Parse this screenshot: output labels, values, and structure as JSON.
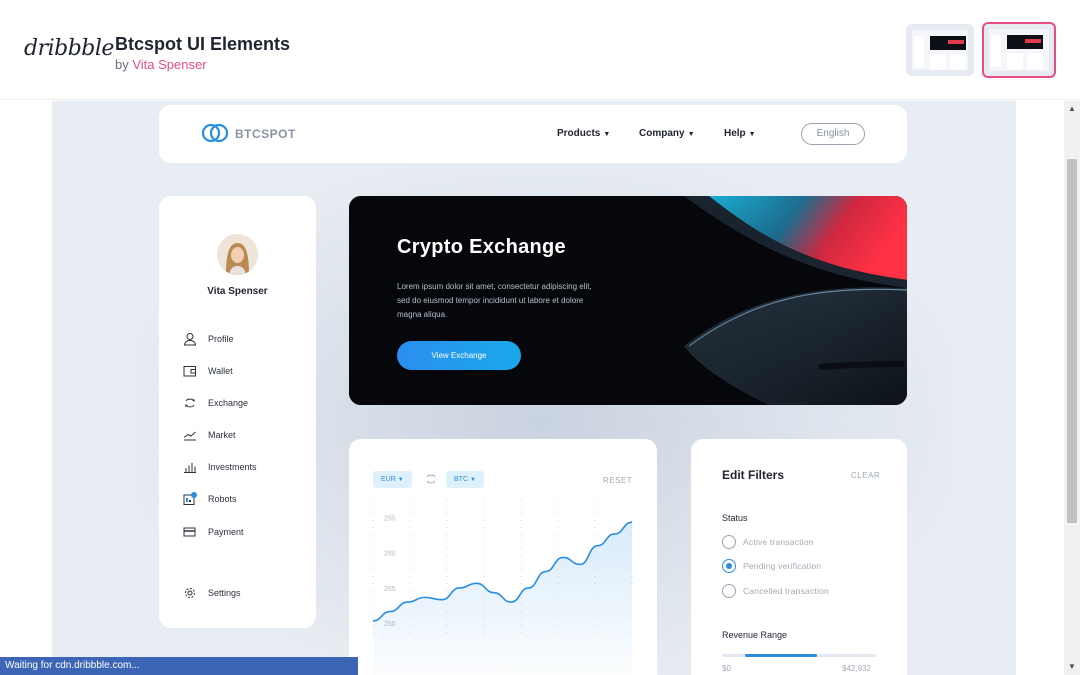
{
  "dribbble": {
    "logo": "dribbble",
    "shot_title": "Btcspot UI Elements",
    "by_prefix": "by",
    "author": "Vita Spenser",
    "thumbnails": [
      {
        "label": "thumbnail-1",
        "selected": false
      },
      {
        "label": "thumbnail-2",
        "selected": true
      }
    ]
  },
  "app": {
    "brand": "BTCSPOT",
    "nav": [
      {
        "label": "Products"
      },
      {
        "label": "Company"
      },
      {
        "label": "Help"
      }
    ],
    "language": "English"
  },
  "sidebar": {
    "user_name": "Vita Spenser",
    "items": [
      {
        "label": "Profile",
        "icon": "user-icon"
      },
      {
        "label": "Wallet",
        "icon": "wallet-icon"
      },
      {
        "label": "Exchange",
        "icon": "exchange-icon"
      },
      {
        "label": "Market",
        "icon": "trend-icon"
      },
      {
        "label": "Investments",
        "icon": "bar-chart-icon"
      },
      {
        "label": "Robots",
        "icon": "robot-icon",
        "badge": "2"
      },
      {
        "label": "Payment",
        "icon": "card-icon"
      },
      {
        "label": "Settings",
        "icon": "gear-icon"
      }
    ]
  },
  "hero": {
    "title": "Crypto Exchange",
    "text": "Lorem ipsum dolor sit amet, consectetur adipiscing elit, sed do eiusmod tempor incididunt ut labore et dolore magna aliqua.",
    "button": "View Exchange"
  },
  "chart_card": {
    "from_currency": "EUR",
    "to_currency": "BTC",
    "reset": "RESET"
  },
  "chart_data": {
    "type": "area",
    "y_ticks": [
      "295",
      "280",
      "265",
      "250"
    ],
    "ylim": [
      245,
      302
    ],
    "grid": true,
    "x": [
      0,
      1,
      2,
      3,
      4,
      5,
      6,
      7,
      8,
      9,
      10,
      11,
      12,
      13,
      14,
      15
    ],
    "values": [
      251,
      255,
      259,
      261,
      260,
      265,
      267,
      263,
      259,
      265,
      272,
      278,
      275,
      283,
      288,
      293
    ]
  },
  "filters": {
    "title": "Edit Filters",
    "clear": "CLEAR",
    "status_label": "Status",
    "options": [
      {
        "label": "Active transaction",
        "checked": false
      },
      {
        "label": "Pending verification",
        "checked": true
      },
      {
        "label": "Cancelled transaction",
        "checked": false
      }
    ],
    "range_label": "Revenue Range",
    "range_min": "$0",
    "range_max": "$42,932",
    "range_selected": [
      0.15,
      0.62
    ]
  },
  "browser": {
    "status_text": "Waiting for cdn.dribbble.com..."
  },
  "colors": {
    "accent": "#2a8ee0",
    "dribbble_pink": "#ea4c89",
    "dark_hero": "#05070b"
  }
}
